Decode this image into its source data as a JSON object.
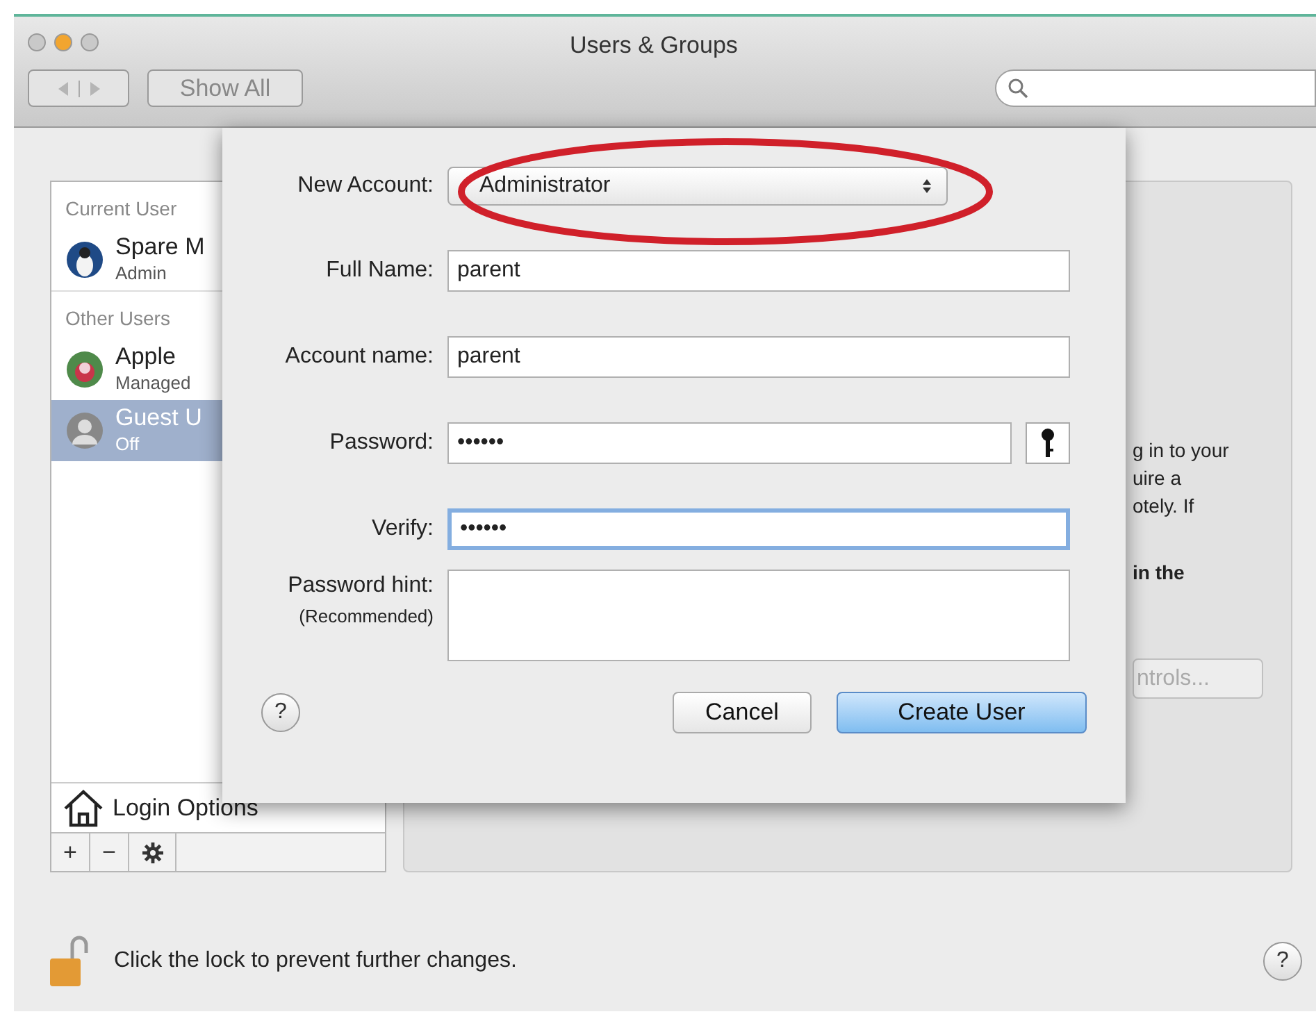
{
  "window": {
    "title": "Users & Groups",
    "lights": [
      {
        "color": "#c9c9c9"
      },
      {
        "color": "#f2a52f"
      },
      {
        "color": "#c9c9c9"
      }
    ]
  },
  "toolbar": {
    "show_all": "Show All"
  },
  "sidebar": {
    "sections": [
      {
        "header": "Current User",
        "users": [
          {
            "name": "Spare M",
            "role": "Admin",
            "kind": "penguin",
            "selected": false
          }
        ]
      },
      {
        "header": "Other Users",
        "users": [
          {
            "name": "Apple",
            "role": "Managed",
            "kind": "flower",
            "selected": false
          },
          {
            "name": "Guest U",
            "role": "Off",
            "kind": "person",
            "selected": true
          }
        ]
      }
    ],
    "login_options": "Login Options",
    "buttons": [
      "+",
      "−"
    ]
  },
  "panel": {
    "fragments": [
      {
        "text": "g in to your",
        "bold": false
      },
      {
        "text": "uire a",
        "bold": false
      },
      {
        "text": "otely. If",
        "bold": false
      },
      {
        "text": "in the",
        "bold": true
      }
    ],
    "button": "ntrols..."
  },
  "sheet": {
    "fields": [
      {
        "kind": "popup",
        "label": "New Account:",
        "value": "Administrator"
      },
      {
        "kind": "text",
        "label": "Full Name:",
        "value": "parent",
        "focused": false
      },
      {
        "kind": "text",
        "label": "Account name:",
        "value": "parent",
        "focused": false
      },
      {
        "kind": "password",
        "label": "Password:",
        "value": "••••••",
        "focused": false,
        "key_button": true
      },
      {
        "kind": "password",
        "label": "Verify:",
        "value": "••••••",
        "focused": true
      },
      {
        "kind": "textarea",
        "label": "Password hint:",
        "note": "(Recommended)",
        "focused": false
      }
    ],
    "help": "?",
    "buttons": [
      {
        "label": "Cancel",
        "default": false
      },
      {
        "label": "Create User",
        "default": true
      }
    ]
  },
  "footer": {
    "lock_text": "Click the lock to prevent further changes.",
    "help": "?"
  }
}
